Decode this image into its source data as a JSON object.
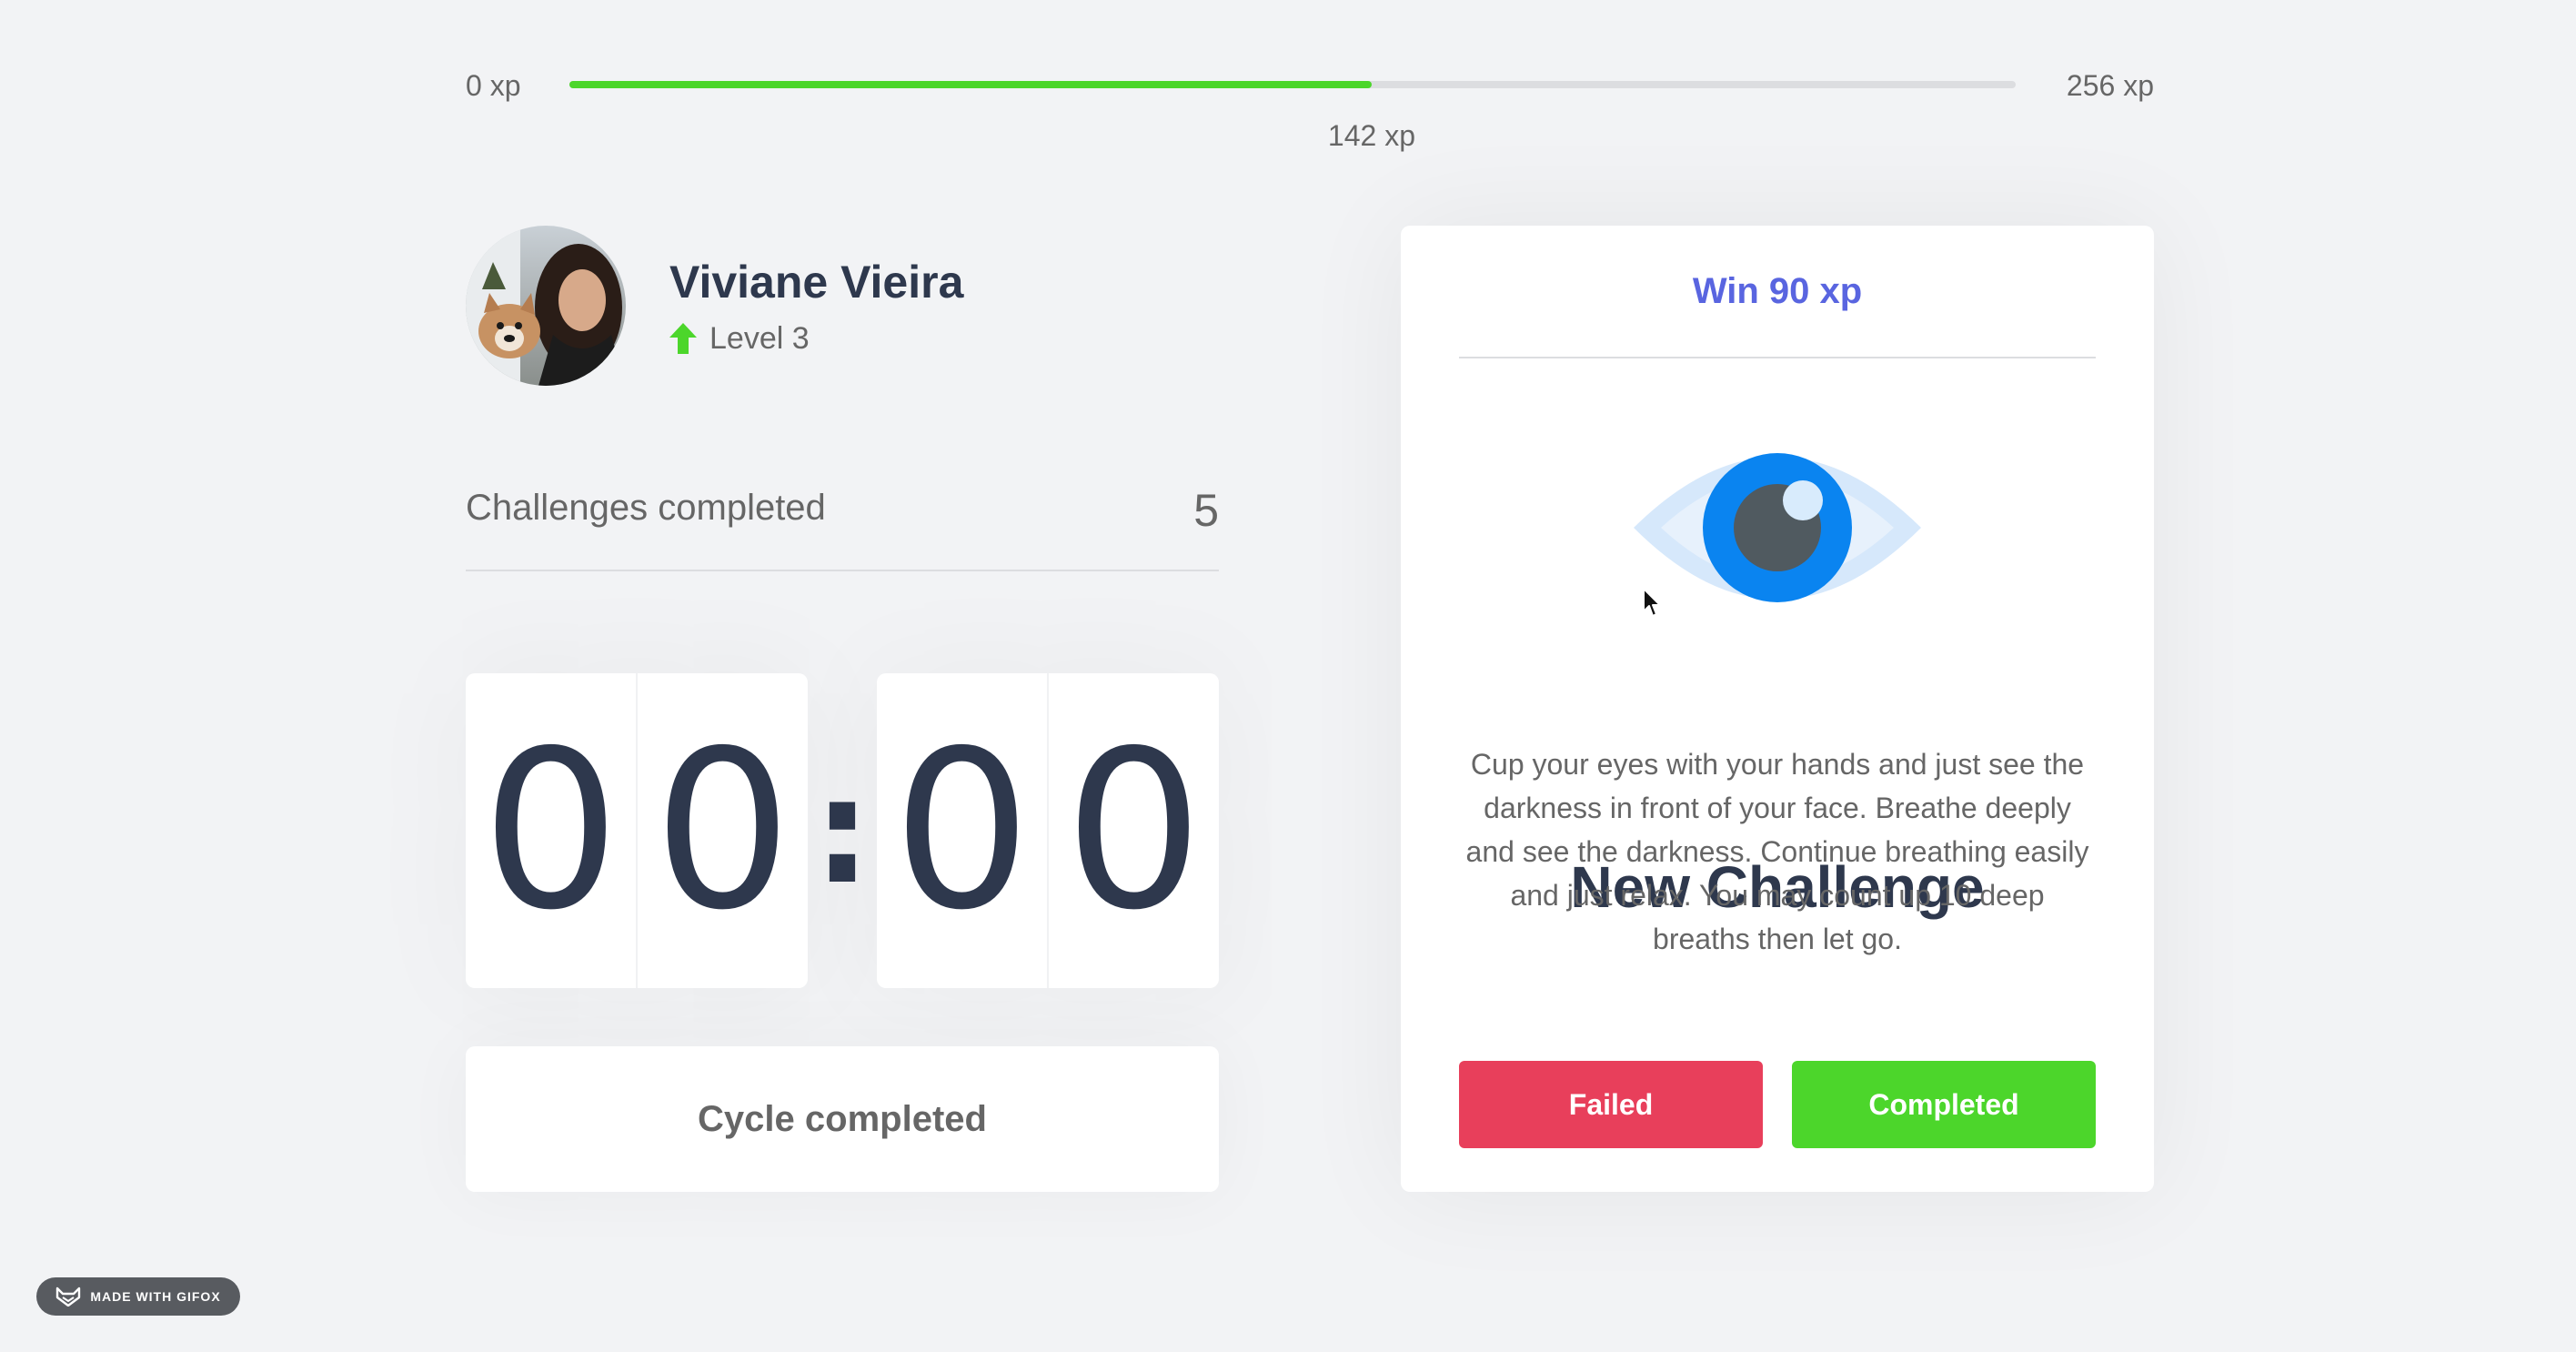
{
  "xp": {
    "min_label": "0 xp",
    "max_label": "256 xp",
    "current_label": "142 xp",
    "current": 142,
    "max": 256,
    "bar_color": "#4cd62b"
  },
  "profile": {
    "name": "Viviane Vieira",
    "level_label": "Level 3",
    "level_icon": "level-up-arrow-icon"
  },
  "challenges": {
    "label": "Challenges completed",
    "count": "5"
  },
  "countdown": {
    "minutes": [
      "0",
      "0"
    ],
    "separator": ":",
    "seconds": [
      "0",
      "0"
    ]
  },
  "cycle_button": {
    "label": "Cycle completed"
  },
  "challenge_card": {
    "reward": "Win 90 xp",
    "icon": "eye-icon",
    "title": "New Challenge",
    "description": "Cup your eyes with your hands and just see the darkness in front of your face. Breathe deeply and see the darkness. Continue breathing easily and just relax. You may count up 10 deep breaths then let go.",
    "failed_label": "Failed",
    "completed_label": "Completed",
    "accent_color": "#5965e0",
    "failed_color": "#e83f5b",
    "completed_color": "#4cd62b"
  },
  "watermark": {
    "label": "MADE WITH GIFOX"
  }
}
